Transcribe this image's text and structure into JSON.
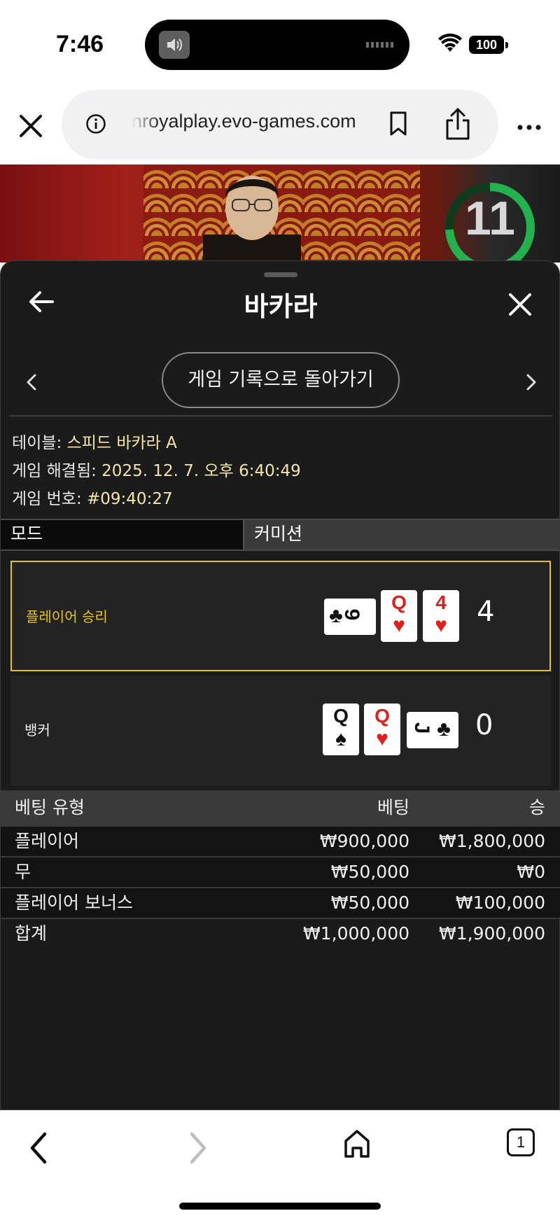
{
  "status_bar": {
    "time": "7:46",
    "battery": "100"
  },
  "browser": {
    "url": "nroyalplay.evo-games.com",
    "icons": [
      "close-icon",
      "info-icon",
      "bookmark-icon",
      "share-icon",
      "more-icon"
    ]
  },
  "video": {
    "timer_value": "11",
    "timer_color": "#22b14c"
  },
  "panel": {
    "title": "바카라",
    "return_button": "게임 기록으로 돌아가기",
    "table_label": "테이블: ",
    "table_value": "스피드 바카라 A",
    "resolved_label": "게임 해결됨: ",
    "resolved_value": "2025. 12. 7. 오후 6:40:49",
    "game_no_label": "게임 번호: ",
    "game_no_value": "#09:40:27",
    "tabs": [
      "모드",
      "커미션"
    ]
  },
  "hands": {
    "player": {
      "label": "플레이어 승리",
      "score": "4",
      "label_color": "#e3c41b",
      "cards": [
        {
          "rank": "9",
          "suit": "♣",
          "color": "black",
          "orientation": "sideways"
        },
        {
          "rank": "Q",
          "suit": "♥",
          "color": "red",
          "orientation": "upright"
        },
        {
          "rank": "4",
          "suit": "♥",
          "color": "red",
          "orientation": "upright"
        }
      ]
    },
    "banker": {
      "label": "뱅커",
      "score": "0",
      "cards": [
        {
          "rank": "Q",
          "suit": "♠",
          "color": "black",
          "orientation": "upright"
        },
        {
          "rank": "Q",
          "suit": "♥",
          "color": "red",
          "orientation": "upright"
        },
        {
          "rank": "J",
          "suit": "♣",
          "color": "black",
          "orientation": "sideways"
        }
      ]
    }
  },
  "bets": {
    "headers": {
      "type": "베팅 유형",
      "bet": "베팅",
      "win": "승"
    },
    "rows": [
      {
        "type": "플레이어",
        "bet": "₩900,000",
        "win": "₩1,800,000"
      },
      {
        "type": "무",
        "bet": "₩50,000",
        "win": "₩0"
      },
      {
        "type": "플레이어 보너스",
        "bet": "₩50,000",
        "win": "₩100,000"
      }
    ],
    "total": {
      "type": "합계",
      "bet": "₩1,000,000",
      "win": "₩1,900,000"
    }
  },
  "toolbar": {
    "tab_count": "1",
    "icons": [
      "back-icon",
      "forward-icon",
      "home-icon",
      "tabs-icon"
    ]
  }
}
